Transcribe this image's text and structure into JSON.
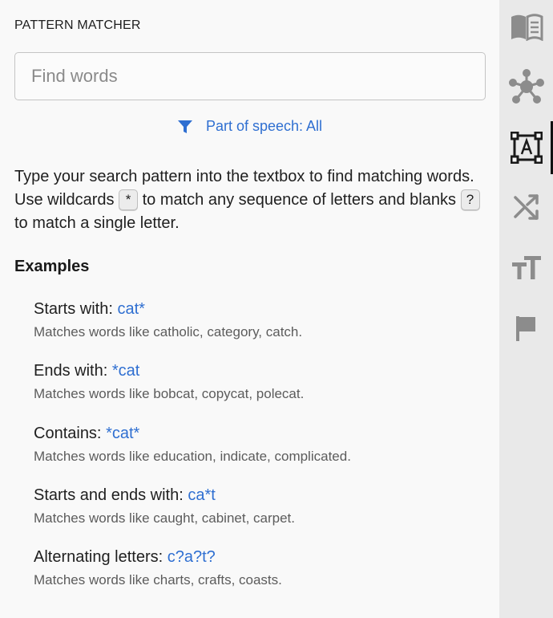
{
  "panel": {
    "title": "PATTERN MATCHER",
    "search_placeholder": "Find words",
    "search_value": "",
    "filter_label": "Part of speech: All",
    "intro": {
      "part1": "Type your search pattern into the textbox to find matching words. Use wildcards ",
      "wildcard_key": "*",
      "part2": " to match any sequence of letters and blanks ",
      "blank_key": "?",
      "part3": " to match a single letter."
    },
    "examples_heading": "Examples",
    "examples": [
      {
        "label": "Starts with: ",
        "pattern": "cat*",
        "desc": "Matches words like catholic, category, catch."
      },
      {
        "label": "Ends with: ",
        "pattern": "*cat",
        "desc": "Matches words like bobcat, copycat, polecat."
      },
      {
        "label": "Contains: ",
        "pattern": "*cat*",
        "desc": "Matches words like education, indicate, complicated."
      },
      {
        "label": "Starts and ends with: ",
        "pattern": "ca*t",
        "desc": "Matches words like caught, cabinet, carpet."
      },
      {
        "label": "Alternating letters: ",
        "pattern": "c?a?t?",
        "desc": "Matches words like charts, crafts, coasts."
      }
    ]
  },
  "rail": {
    "items": [
      {
        "icon": "book-icon",
        "active": false
      },
      {
        "icon": "network-icon",
        "active": false
      },
      {
        "icon": "pattern-matcher-icon",
        "active": true
      },
      {
        "icon": "shuffle-icon",
        "active": false
      },
      {
        "icon": "text-size-icon",
        "active": false
      },
      {
        "icon": "flag-icon",
        "active": false
      }
    ]
  },
  "colors": {
    "accent": "#2f6fd1",
    "rail_bg": "#e9e9e9",
    "rail_icon": "#8c8c8c",
    "active_icon": "#1a1a1a"
  }
}
